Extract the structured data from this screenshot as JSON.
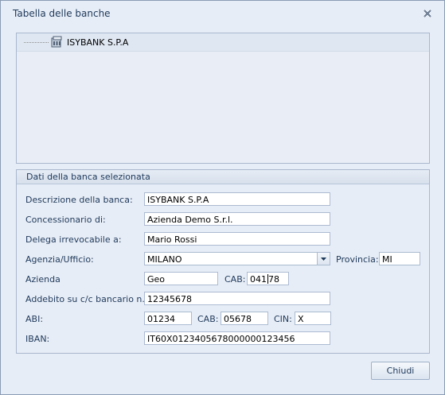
{
  "window": {
    "title": "Tabella delle banche"
  },
  "tree": {
    "items": [
      {
        "label": "ISYBANK S.P.A"
      }
    ]
  },
  "group": {
    "title": "Dati della banca selezionata"
  },
  "form": {
    "descrizione_label": "Descrizione della banca:",
    "descrizione_value": "ISYBANK S.P.A",
    "concessionario_label": "Concessionario di:",
    "concessionario_value": "Azienda Demo S.r.l.",
    "delega_label": "Delega irrevocabile a:",
    "delega_value": "Mario Rossi",
    "agenzia_label": "Agenzia/Ufficio:",
    "agenzia_value": "MILANO",
    "provincia_label": "Provincia:",
    "provincia_value": "MI",
    "azienda_label": "Azienda",
    "azienda_value": "Geo",
    "cab1_label": "CAB:",
    "cab1_value_before_caret": "041",
    "cab1_value_after_caret": "78",
    "addebito_label": "Addebito su c/c bancario n.:",
    "addebito_value": "12345678",
    "abi_label": "ABI:",
    "abi_value": "01234",
    "cab2_label": "CAB:",
    "cab2_value": "05678",
    "cin_label": "CIN:",
    "cin_value": "X",
    "iban_label": "IBAN:",
    "iban_value": "IT60X0123405678000000123456"
  },
  "buttons": {
    "close_label": "Chiudi"
  },
  "icons": {
    "close": "close-x-icon",
    "bank": "bank-icon",
    "dropdown": "chevron-down-icon"
  }
}
